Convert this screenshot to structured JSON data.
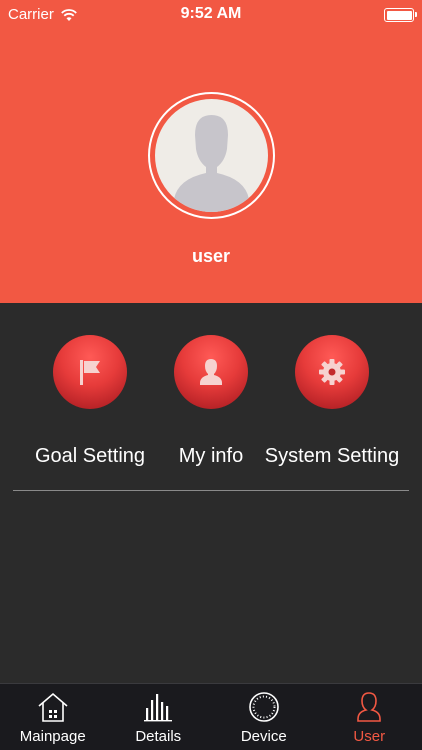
{
  "status_bar": {
    "carrier": "Carrier",
    "time": "9:52 AM",
    "battery_level": 1.0
  },
  "profile": {
    "username": "user"
  },
  "actions": [
    {
      "label": "Goal Setting",
      "icon": "flag-icon"
    },
    {
      "label": "My info",
      "icon": "person-icon"
    },
    {
      "label": "System Setting",
      "icon": "gear-icon"
    }
  ],
  "tabbar": {
    "items": [
      {
        "label": "Mainpage",
        "icon": "house-icon"
      },
      {
        "label": "Details",
        "icon": "bar-chart-icon"
      },
      {
        "label": "Device",
        "icon": "device-dial-icon"
      },
      {
        "label": "User",
        "icon": "user-icon"
      }
    ],
    "active": "User"
  },
  "colors": {
    "accent": "#f25843",
    "background": "#2b2b2b",
    "tabbar": "#1a1a1e"
  }
}
